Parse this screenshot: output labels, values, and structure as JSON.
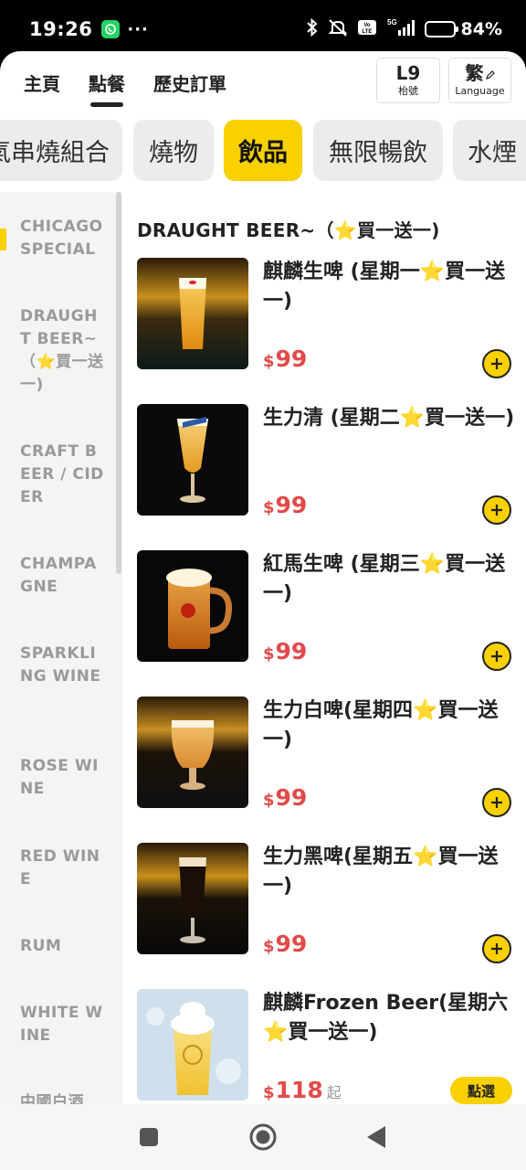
{
  "status_bar": {
    "time": "19:26",
    "battery": "84%",
    "icons": [
      "whatsapp-icon",
      "more-dots-icon",
      "bluetooth-icon",
      "silent-icon",
      "volte-icon",
      "signal-5g-icon",
      "battery-icon"
    ],
    "dots": "···"
  },
  "header": {
    "tabs": [
      {
        "label": "主頁"
      },
      {
        "label": "點餐"
      },
      {
        "label": "歷史訂單"
      }
    ],
    "active_tab": "點餐",
    "table": {
      "number": "L9",
      "label": "枱號"
    },
    "language": {
      "code": "繁",
      "label": "Language"
    }
  },
  "categories": [
    {
      "label": "氣串燒組合"
    },
    {
      "label": "燒物"
    },
    {
      "label": "飲品"
    },
    {
      "label": "無限暢飲"
    },
    {
      "label": "水煙"
    }
  ],
  "active_category": "飲品",
  "sidebar": {
    "items": [
      {
        "label": "CHICAGO SPECIAL"
      },
      {
        "label": "DRAUGHT BEER~（⭐買一送一)"
      },
      {
        "label": "CRAFT BEER / CIDER"
      },
      {
        "label": "CHAMPAGNE"
      },
      {
        "label": "SPARKLING WINE"
      },
      {
        "label": "ROSE WINE"
      },
      {
        "label": "RED WINE"
      },
      {
        "label": "RUM"
      },
      {
        "label": "WHITE WINE"
      },
      {
        "label": "中國白酒"
      }
    ]
  },
  "section": {
    "title": "DRAUGHT BEER~（⭐買一送一)"
  },
  "menu_items": [
    {
      "name": "麒麟生啤 (星期一⭐買一送一)",
      "currency": "$",
      "price": "99",
      "suffix": "",
      "action": "add"
    },
    {
      "name": "生力清 (星期二⭐買一送一)",
      "currency": "$",
      "price": "99",
      "suffix": "",
      "action": "add"
    },
    {
      "name": "紅馬生啤 (星期三⭐買一送一)",
      "currency": "$",
      "price": "99",
      "suffix": "",
      "action": "add"
    },
    {
      "name": "生力白啤(星期四⭐買一送一)",
      "currency": "$",
      "price": "99",
      "suffix": "",
      "action": "add"
    },
    {
      "name": "生力黑啤(星期五⭐買一送一)",
      "currency": "$",
      "price": "99",
      "suffix": "",
      "action": "add"
    },
    {
      "name": "麒麟Frozen Beer(星期六⭐買一送一)",
      "currency": "$",
      "price": "118",
      "suffix": "起",
      "action": "select",
      "action_label": "點選"
    }
  ],
  "colors": {
    "accent": "#f9d000",
    "price": "#e24a4a",
    "sidebar_bg": "#f4f4f4",
    "chip_bg": "#ececec"
  }
}
